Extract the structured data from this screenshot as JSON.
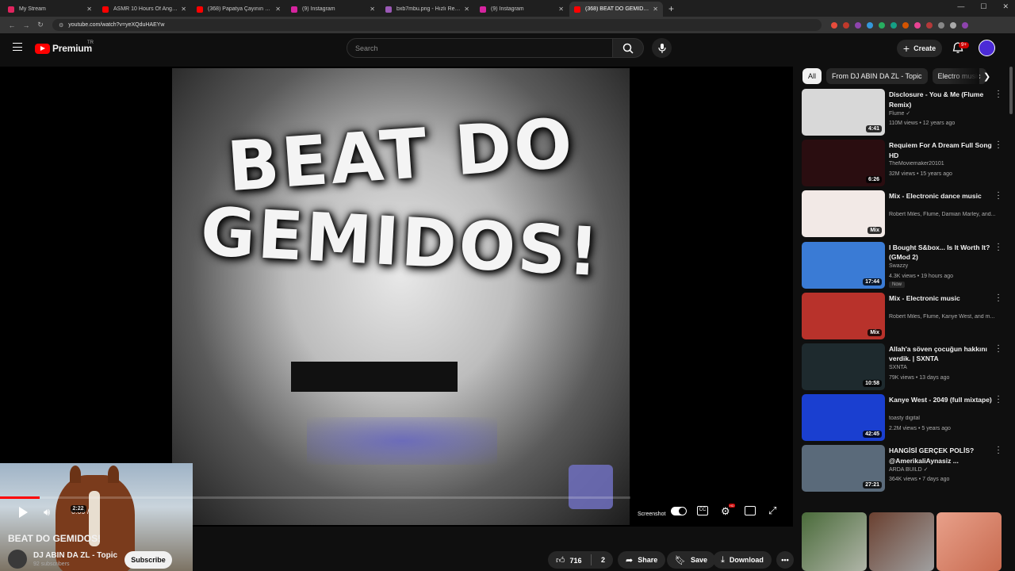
{
  "browser": {
    "tabs": [
      {
        "label": "My Stream",
        "color": "#e0245e"
      },
      {
        "label": "ASMR 10 Hours Of Angle Grind",
        "color": "#ff0000"
      },
      {
        "label": "(368) Papatya Çayının Faydaları",
        "color": "#ff0000"
      },
      {
        "label": "(9) Instagram",
        "color": "#d6249f"
      },
      {
        "label": "bxb7mbu.png - Hızlı Resim",
        "color": "#9b59b6"
      },
      {
        "label": "(9) Instagram",
        "color": "#d6249f"
      },
      {
        "label": "(368) BEAT DO GEMIDOS! - You",
        "color": "#ff0000"
      }
    ],
    "url": "youtube.com/watch?v=yeXQduHAEYw"
  },
  "header": {
    "brand": "Premium",
    "region": "TR",
    "search_placeholder": "Search",
    "create_label": "Create",
    "notif_badge": "9+"
  },
  "player": {
    "art_line1": "BEAT DO",
    "art_line2": "GEMIDOS!",
    "time_current": "0:09",
    "time_total": "2:22",
    "progress_fraction": 0.063,
    "screenshot_label": "Screenshot",
    "cc_label": "CC",
    "hd_badge": "HD"
  },
  "video": {
    "title": "BEAT DO GEMIDOS!",
    "channel": "DJ ABIN DA ZL - Topic",
    "subscribers": "92 subscribers",
    "subscribe_label": "Subscribe",
    "likes": "716",
    "comments_count": "2",
    "share_label": "Share",
    "save_label": "Save",
    "download_label": "Download"
  },
  "sidebar": {
    "chips": [
      "All",
      "From DJ ABIN DA ZL - Topic",
      "Electro music"
    ],
    "recommendations": [
      {
        "title": "Disclosure - You & Me (Flume Remix)",
        "channel": "Flume ✓",
        "meta": "110M views • 12 years ago",
        "duration": "4:41",
        "thumb": "#d8d8d8",
        "new": ""
      },
      {
        "title": "Requiem For A Dream Full Song HD",
        "channel": "TheMoviemaker20101",
        "meta": "32M views • 15 years ago",
        "duration": "6:26",
        "thumb": "#2a0d10",
        "new": ""
      },
      {
        "title": "Mix - Electronic dance music",
        "channel": "Robert Miles, Flume, Damian Marley, and...",
        "meta": "",
        "duration": "Mix",
        "thumb": "#f2e9e6",
        "new": ""
      },
      {
        "title": "I Bought S&box... Is It Worth It? (GMod 2)",
        "channel": "Swazzy",
        "meta": "4.3K views • 19 hours ago",
        "duration": "17:44",
        "thumb": "#3a7bd5",
        "new": "Now"
      },
      {
        "title": "Mix - Electronic music",
        "channel": "Robert Miles, Flume, Kanye West, and m...",
        "meta": "",
        "duration": "Mix",
        "thumb": "#b8322b",
        "new": ""
      },
      {
        "title": "Allah'a söven çocuğun hakkını verdik. | SXNTA",
        "channel": "SXNTA",
        "meta": "79K views • 13 days ago",
        "duration": "10:58",
        "thumb": "#1e2a2e",
        "new": ""
      },
      {
        "title": "Kanye West - 2049 (full mixtape)",
        "channel": "toasty digital",
        "meta": "2.2M views • 5 years ago",
        "duration": "42:45",
        "thumb": "#1a3fd0",
        "new": ""
      },
      {
        "title": "HANGİSİ GERÇEK POLİS? @AmerikaliAynasiz ...",
        "channel": "ARDA BUILD ✓",
        "meta": "364K views • 7 days ago",
        "duration": "27:21",
        "thumb": "#5a6a7a",
        "new": ""
      }
    ]
  }
}
